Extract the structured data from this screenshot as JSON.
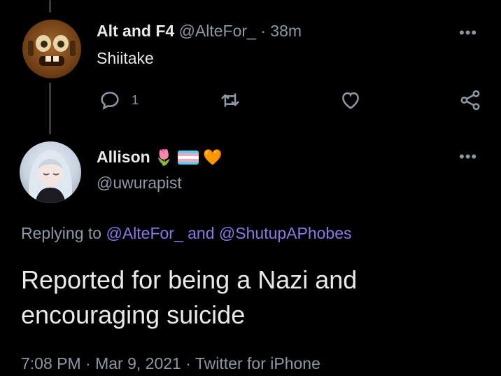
{
  "tweet1": {
    "display_name": "Alt and F4",
    "handle": "@AlteFor_",
    "separator": "·",
    "time_ago": "38m",
    "text": "Shiitake",
    "reply_count": "1",
    "avatar_icon": "tow-truck-avatar",
    "more_icon": "•••"
  },
  "tweet2": {
    "display_name": "Allison",
    "name_emojis": {
      "tulip": "🌷",
      "heart": "🧡"
    },
    "handle": "@uwurapist",
    "avatar_icon": "anime-girl-avatar",
    "more_icon": "•••",
    "replying_prefix": "Replying to",
    "replying_user1": "@AlteFor_",
    "replying_and": "and",
    "replying_user2": "@ShutupAPhobes",
    "text": "Reported for being a Nazi and encouraging suicide",
    "time": "7:08 PM",
    "date": "Mar 9, 2021",
    "source": "Twitter for iPhone",
    "sep": "·"
  },
  "colors": {
    "background": "#000000",
    "text_primary": "#e7e9ea",
    "text_secondary": "#8b98a5",
    "mention": "#8b78e6",
    "trans_blue": "#5bcefa",
    "trans_pink": "#f5a9b8",
    "trans_white": "#ffffff"
  }
}
